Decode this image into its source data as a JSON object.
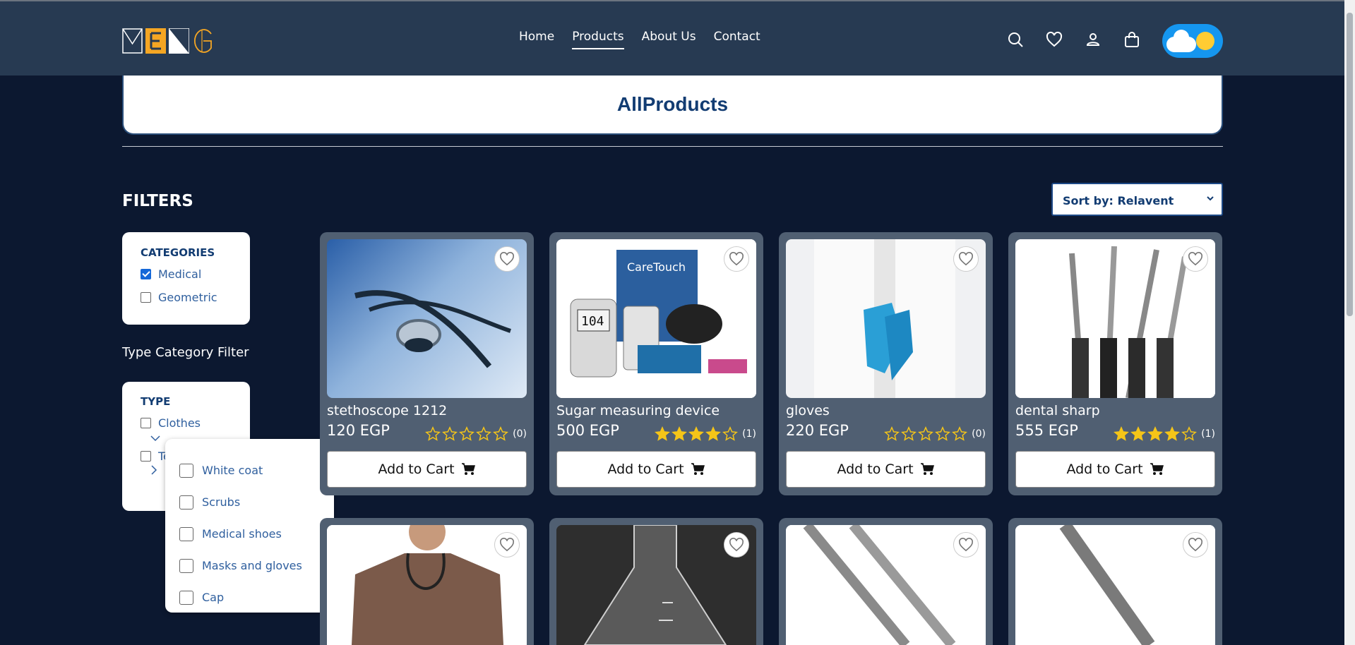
{
  "header": {
    "logo_text": "MENG",
    "nav": [
      {
        "label": "Home",
        "active": false
      },
      {
        "label": "Products",
        "active": true
      },
      {
        "label": "About Us",
        "active": false
      },
      {
        "label": "Contact",
        "active": false
      }
    ],
    "icons": [
      "search-icon",
      "heart-icon",
      "user-icon",
      "bag-icon"
    ]
  },
  "page_title": "AllProducts",
  "filters": {
    "title": "FILTERS",
    "categories": {
      "title": "CATEGORIES",
      "options": [
        {
          "label": "Medical",
          "checked": true
        },
        {
          "label": "Geometric",
          "checked": false
        }
      ]
    },
    "type_label": "Type Category Filter",
    "type": {
      "title": "TYPE",
      "options": [
        {
          "label": "Clothes",
          "checked": false
        },
        {
          "label": "Te",
          "checked": false
        }
      ]
    },
    "type_dropdown": [
      {
        "label": "White coat"
      },
      {
        "label": "Scrubs"
      },
      {
        "label": "Medical shoes"
      },
      {
        "label": "Masks and gloves"
      },
      {
        "label": "Cap"
      }
    ]
  },
  "sort": {
    "label": "Sort by: Relavent"
  },
  "products": [
    {
      "name": "stethoscope 1212",
      "price": "120 EGP",
      "stars": 0,
      "reviews": "(0)"
    },
    {
      "name": "Sugar measuring device",
      "price": "500 EGP",
      "stars": 4,
      "reviews": "(1)"
    },
    {
      "name": "gloves",
      "price": "220 EGP",
      "stars": 0,
      "reviews": "(0)"
    },
    {
      "name": "dental sharp",
      "price": "555 EGP",
      "stars": 4,
      "reviews": "(1)"
    }
  ],
  "add_to_cart_label": "Add to Cart",
  "colors": {
    "accent": "#f5a623",
    "brand_blue": "#123c72",
    "star": "#f5c518"
  }
}
